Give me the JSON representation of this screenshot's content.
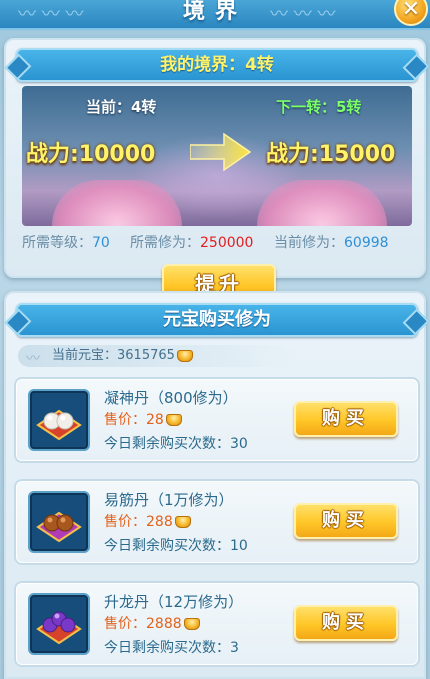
{
  "window": {
    "title": "境界",
    "close_symbol": "✕"
  },
  "realm": {
    "banner": "我的境界：4转",
    "current_label": "当前：4转",
    "next_label": "下一转：5转",
    "current_power": "战力:10000",
    "next_power": "战力:15000",
    "stats": {
      "level_label": "所需等级：",
      "level_value": "70",
      "cultivation_label": "所需修为：",
      "cultivation_value": "250000",
      "current_label": "当前修为：",
      "current_value": "60998"
    },
    "upgrade_button": "提升"
  },
  "shop": {
    "banner": "元宝购买修为",
    "balance_label": "当前元宝：",
    "balance_value": "3615765",
    "items": [
      {
        "name": "凝神丹（800修为）",
        "price_label": "售价：",
        "price_value": "28",
        "remain_label": "今日剩余购买次数：",
        "remain_value": "30",
        "buy_label": "购买",
        "icon": "white-pills-icon",
        "cushion_color": "#d6432a",
        "pill_color": "#f2eee8"
      },
      {
        "name": "易筋丹（1万修为）",
        "price_label": "售价：",
        "price_value": "288",
        "remain_label": "今日剩余购买次数：",
        "remain_value": "10",
        "buy_label": "购买",
        "icon": "brown-pills-icon",
        "cushion_color": "#b23bb5",
        "pill_color": "#a8571f"
      },
      {
        "name": "升龙丹（12万修为）",
        "price_label": "售价：",
        "price_value": "2888",
        "remain_label": "今日剩余购买次数：",
        "remain_value": "3",
        "buy_label": "购买",
        "icon": "purple-pills-icon",
        "cushion_color": "#d6432a",
        "pill_color": "#7a38c9"
      }
    ]
  },
  "colors": {
    "accent_blue": "#2a94d2",
    "gold": "#ffc627",
    "red_value": "#e31d1d",
    "green_next": "#7dff6a"
  }
}
